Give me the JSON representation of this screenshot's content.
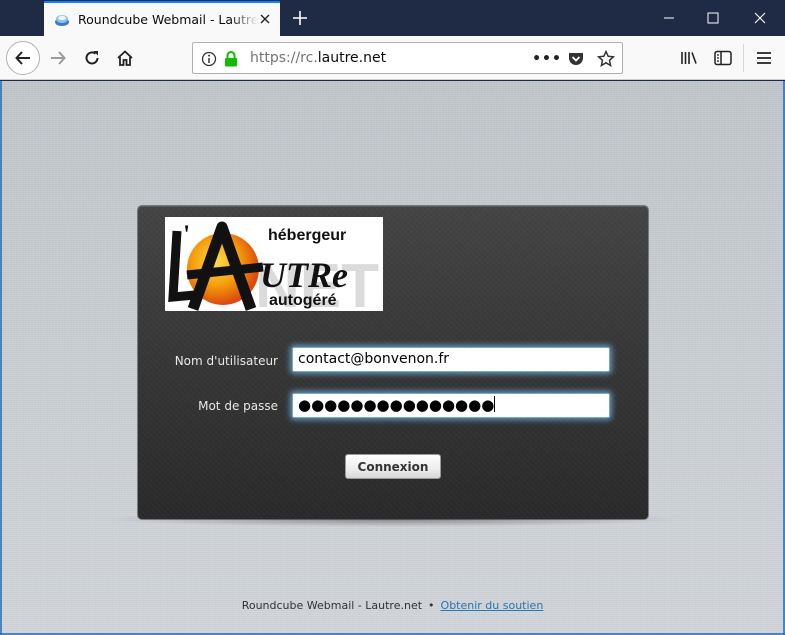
{
  "browser": {
    "tab_title": "Roundcube Webmail - Lautre.net",
    "url_scheme": "https://rc.",
    "url_host": "lautre.net",
    "page_actions": "•••"
  },
  "login": {
    "logo_line1": "hébergeur",
    "logo_line2": "autogéré",
    "logo_mark": "L'AUTRE",
    "username_label": "Nom d'utilisateur",
    "username_value": "contact@bonvenon.fr",
    "password_label": "Mot de passe",
    "password_value": "●●●●●●●●●●●●●●●",
    "submit_label": "Connexion"
  },
  "footer": {
    "product": "Roundcube Webmail - Lautre.net",
    "separator": "•",
    "support_link": "Obtenir du soutien"
  },
  "colors": {
    "titlebar": "#1f2a44",
    "tab_accent": "#0a84ff",
    "lock_green": "#12bc00",
    "link": "#2675b4"
  }
}
